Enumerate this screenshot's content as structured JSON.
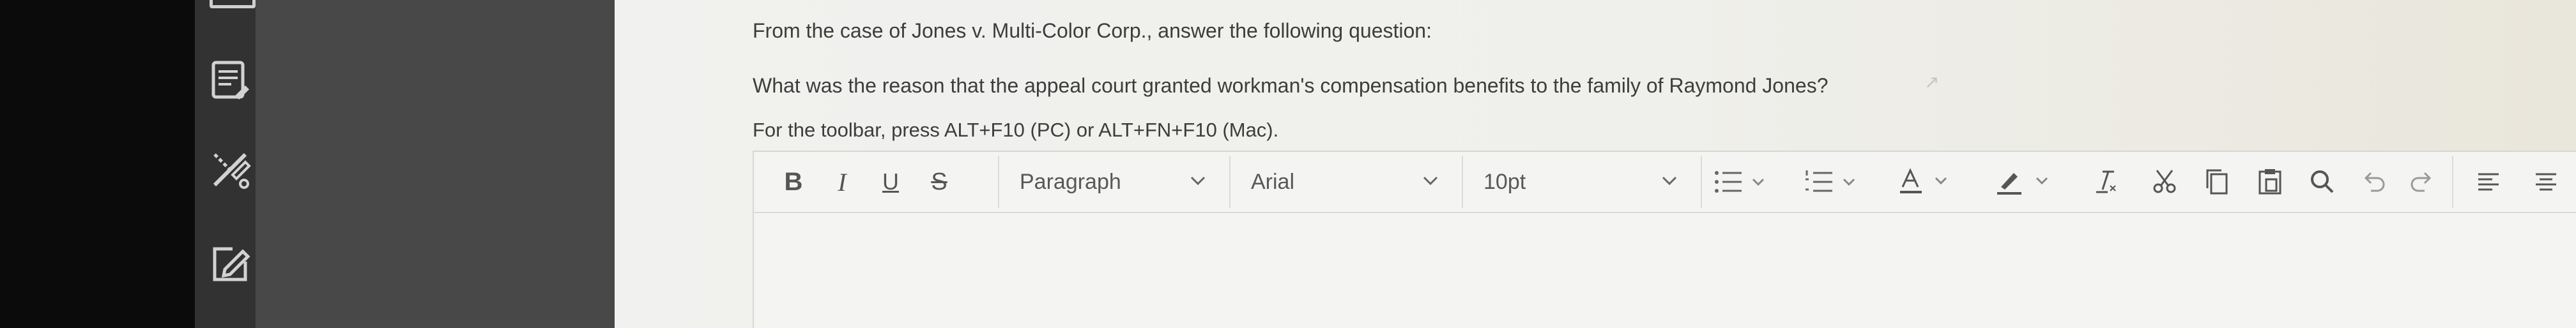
{
  "sidebar": {
    "icons": [
      "document-icon",
      "pen-tool-icon",
      "edit-icon"
    ]
  },
  "question": {
    "intro": "From the case of Jones v. Multi-Color Corp., answer the following question:",
    "prompt": "What was the reason that the appeal court granted workman's compensation benefits to the family of Raymond Jones?",
    "toolbar_hint": "For the toolbar, press ALT+F10 (PC) or ALT+FN+F10 (Mac)."
  },
  "toolbar": {
    "bold_label": "B",
    "italic_label": "I",
    "underline_label": "U",
    "strike_label": "S",
    "paragraph_value": "Paragraph",
    "font_value": "Arial",
    "size_value": "10pt"
  },
  "colors": {
    "accent_text": "#555555",
    "content_bg": "#f0f0ee",
    "rail_bg": "#323232",
    "nav_bg": "#484848"
  }
}
